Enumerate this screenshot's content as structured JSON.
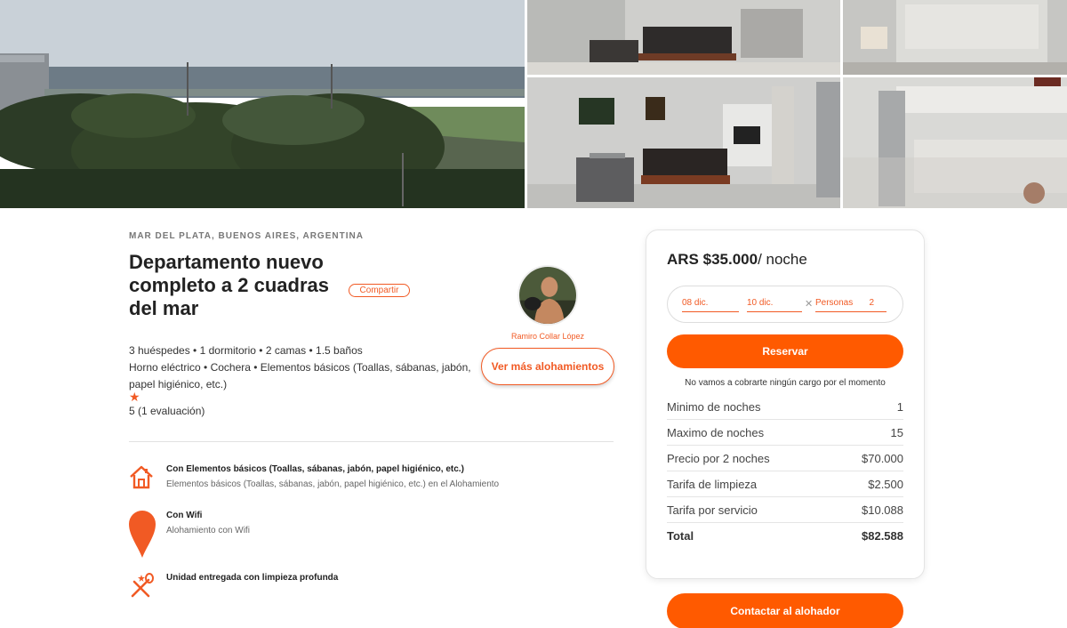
{
  "listing": {
    "location": "MAR DEL PLATA, BUENOS AIRES, ARGENTINA",
    "title": "Departamento nuevo completo a 2 cuadras del mar",
    "share_label": "Compartir",
    "features_line1": "3 huéspedes • 1 dormitorio • 2 camas • 1.5 baños",
    "features_line2": "Horno eléctrico • Cochera • Elementos básicos (Toallas, sábanas, jabón, papel higiénico, etc.)",
    "rating_text": "5 (1 evaluación)",
    "star": "★"
  },
  "host": {
    "name": "Ramiro Collar López",
    "more_label": "Ver más alohamientos"
  },
  "amenities": [
    {
      "title": "Con Elementos básicos (Toallas, sábanas, jabón, papel higiénico, etc.)",
      "description": "Elementos básicos (Toallas, sábanas, jabón, papel higiénico, etc.) en el Alohamiento",
      "icon": "house-icon"
    },
    {
      "title": "Con Wifi",
      "description": "Alohamiento con Wifi",
      "icon": "map-pin-icon"
    },
    {
      "title": "Unidad entregada con limpieza profunda",
      "description": "",
      "icon": "cleaning-icon"
    }
  ],
  "booking": {
    "price": "ARS $35.000",
    "per_night": "/ noche",
    "checkin": "08 dic.",
    "checkout": "10 dic.",
    "clear": "✕",
    "guests_label": "Personas",
    "guests_value": "2",
    "reserve_label": "Reservar",
    "no_charge": "No vamos a cobrarte ningún cargo por el momento",
    "rows": [
      {
        "label": "Minimo de noches",
        "value": "1"
      },
      {
        "label": "Maximo de noches",
        "value": "15"
      },
      {
        "label": "Precio por 2 noches",
        "value": "$70.000"
      },
      {
        "label": "Tarifa de limpieza",
        "value": "$2.500"
      },
      {
        "label": "Tarifa por servicio",
        "value": "$10.088"
      },
      {
        "label": "Total",
        "value": "$82.588"
      }
    ]
  },
  "contact_label": "Contactar al alohador",
  "colors": {
    "accent": "#ff5a00",
    "accent_text": "#f15a24"
  }
}
